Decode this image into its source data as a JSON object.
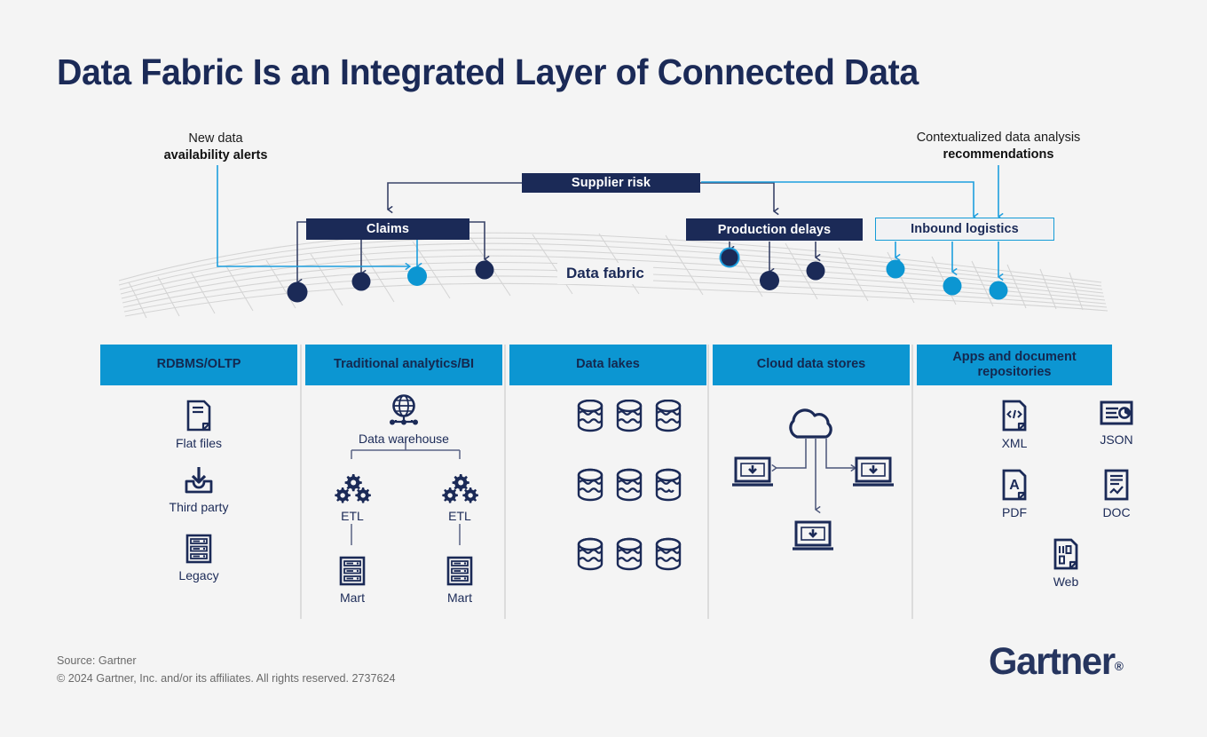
{
  "title": "Data Fabric Is an Integrated Layer of Connected Data",
  "annotations": {
    "left": {
      "line1": "New data",
      "line2": "availability alerts"
    },
    "right": {
      "line1": "Contextualized data analysis",
      "line2": "recommendations"
    }
  },
  "flow": {
    "supplier_risk": "Supplier risk",
    "claims": "Claims",
    "production_delays": "Production delays",
    "inbound_logistics": "Inbound logistics",
    "fabric_label": "Data fabric"
  },
  "colors": {
    "navy": "#1b2a57",
    "blue": "#0c96d2",
    "light_blue": "#1d9ede",
    "background": "#f4f4f4",
    "mesh": "#d2d2d2",
    "divider": "#dcdcdc",
    "footer_text": "#6a6a6a"
  },
  "columns": [
    {
      "header": "RDBMS/OLTP",
      "items": [
        {
          "label": "Flat files",
          "icon": "document-icon"
        },
        {
          "label": "Third party",
          "icon": "inbox-download-icon"
        },
        {
          "label": "Legacy",
          "icon": "server-rack-icon"
        }
      ]
    },
    {
      "header": "Traditional analytics/BI",
      "items": [
        {
          "label": "Data warehouse",
          "icon": "globe-network-icon"
        },
        {
          "label": "ETL",
          "icon": "gears-icon"
        },
        {
          "label": "ETL",
          "icon": "gears-icon"
        },
        {
          "label": "Mart",
          "icon": "server-rack-icon"
        },
        {
          "label": "Mart",
          "icon": "server-rack-icon"
        }
      ]
    },
    {
      "header": "Data lakes",
      "items": [
        {
          "label": "",
          "icon": "data-lake-cylinder-icon"
        },
        {
          "label": "",
          "icon": "data-lake-cylinder-icon"
        },
        {
          "label": "",
          "icon": "data-lake-cylinder-icon"
        },
        {
          "label": "",
          "icon": "data-lake-cylinder-icon"
        },
        {
          "label": "",
          "icon": "data-lake-cylinder-icon"
        },
        {
          "label": "",
          "icon": "data-lake-cylinder-icon"
        },
        {
          "label": "",
          "icon": "data-lake-cylinder-icon"
        },
        {
          "label": "",
          "icon": "data-lake-cylinder-icon"
        },
        {
          "label": "",
          "icon": "data-lake-cylinder-icon"
        }
      ]
    },
    {
      "header": "Cloud data stores",
      "items": [
        {
          "label": "",
          "icon": "cloud-icon"
        },
        {
          "label": "",
          "icon": "laptop-download-icon"
        },
        {
          "label": "",
          "icon": "laptop-download-icon"
        },
        {
          "label": "",
          "icon": "laptop-download-icon"
        }
      ]
    },
    {
      "header": "Apps and document repositories",
      "items": [
        {
          "label": "XML",
          "icon": "xml-file-icon"
        },
        {
          "label": "JSON",
          "icon": "json-report-icon"
        },
        {
          "label": "PDF",
          "icon": "pdf-file-icon"
        },
        {
          "label": "DOC",
          "icon": "doc-file-icon"
        },
        {
          "label": "Web",
          "icon": "web-file-icon"
        }
      ]
    }
  ],
  "footer": {
    "source": "Source: Gartner",
    "copyright": "© 2024 Gartner, Inc. and/or its affiliates. All rights reserved. 2737624",
    "logo": "Gartner",
    "logo_mark": "®"
  }
}
